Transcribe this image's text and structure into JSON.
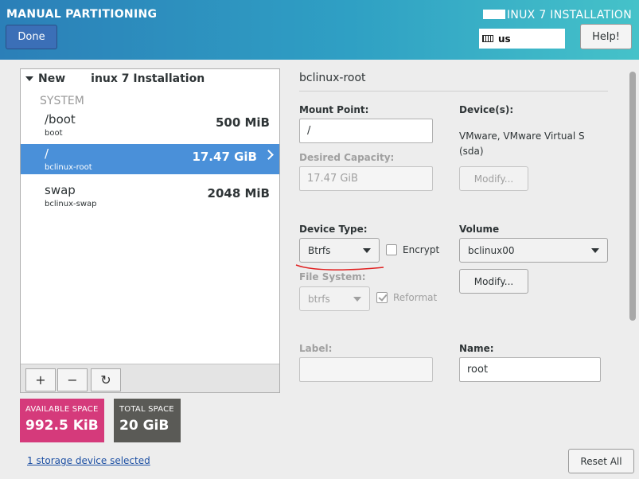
{
  "header": {
    "title": "MANUAL PARTITIONING",
    "done_label": "Done",
    "install_title": "INUX 7 INSTALLATION",
    "keyboard_layout": "us",
    "help_label": "Help!"
  },
  "left": {
    "install_label": "New L  inux 7 Installation",
    "install_label_a": "New",
    "install_label_b": "inux 7 Installation",
    "system_label": "SYSTEM",
    "mount_points": [
      {
        "name": "/boot",
        "device": "boot",
        "size": "500 MiB"
      },
      {
        "name": "/",
        "device": "bclinux-root",
        "size": "17.47 GiB"
      },
      {
        "name": "swap",
        "device": "bclinux-swap",
        "size": "2048 MiB"
      }
    ],
    "add_label": "+",
    "remove_label": "−",
    "refresh_label": "↻"
  },
  "space": {
    "available_label": "AVAILABLE SPACE",
    "available_value": "992.5 KiB",
    "total_label": "TOTAL SPACE",
    "total_value": "20 GiB"
  },
  "footer": {
    "storage_link": "1 storage device selected",
    "reset_label": "Reset All"
  },
  "detail": {
    "title": "bclinux-root",
    "mount_point_label": "Mount Point:",
    "mount_point_value": "/",
    "desired_capacity_label": "Desired Capacity:",
    "desired_capacity_value": "17.47 GiB",
    "devices_label": "Device(s):",
    "devices_line1": "VMware, VMware Virtual S",
    "devices_line2": "(sda)",
    "modify_label": "Modify...",
    "device_type_label": "Device Type:",
    "device_type_value": "Btrfs",
    "encrypt_label": "Encrypt",
    "volume_label": "Volume",
    "volume_value": "bclinux00",
    "volume_modify_label": "Modify...",
    "file_system_label": "File System:",
    "file_system_value": "btrfs",
    "reformat_label": "Reformat",
    "label_label": "Label:",
    "label_value": "",
    "name_label": "Name:",
    "name_value": "root"
  },
  "colors": {
    "header_start": "#2b7fb8",
    "header_end": "#45c2c9",
    "selection": "#4a90d9",
    "available_bg": "#d53a7b",
    "total_bg": "#5a5a56",
    "annotation_red": "#e02020"
  }
}
